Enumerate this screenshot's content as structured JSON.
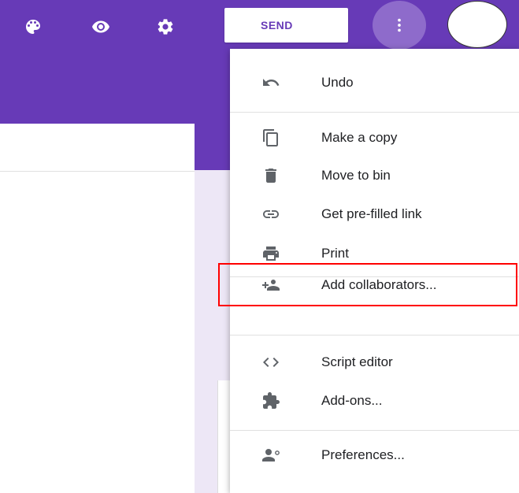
{
  "header": {
    "send_label": "SEND",
    "icons": [
      "palette-icon",
      "eye-icon",
      "gear-icon",
      "more-vert-icon",
      "avatar"
    ]
  },
  "menu": {
    "items": [
      {
        "icon": "undo-icon",
        "label": "Undo"
      },
      {
        "icon": "copy-icon",
        "label": "Make a copy"
      },
      {
        "icon": "trash-icon",
        "label": "Move to bin"
      },
      {
        "icon": "link-icon",
        "label": "Get pre-filled link"
      },
      {
        "icon": "print-icon",
        "label": "Print"
      },
      {
        "icon": "add-people-icon",
        "label": "Add collaborators..."
      },
      {
        "icon": "code-icon",
        "label": "Script editor"
      },
      {
        "icon": "puzzle-icon",
        "label": "Add-ons..."
      },
      {
        "icon": "person-settings-icon",
        "label": "Preferences..."
      }
    ],
    "highlighted_item": "Add collaborators..."
  },
  "colors": {
    "brand": "#673ab7",
    "highlight": "#ff0000",
    "background": "#ede7f6"
  }
}
